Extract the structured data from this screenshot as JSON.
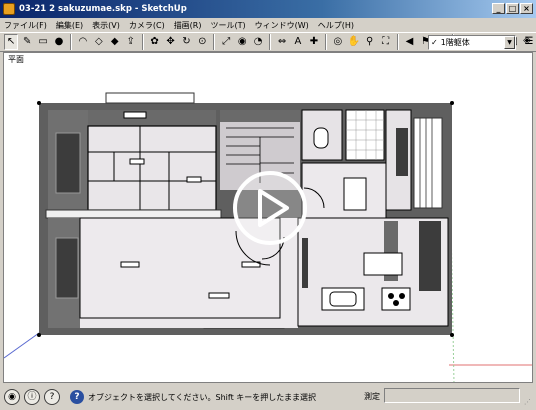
{
  "window": {
    "title": "03-21 2 sakuzumae.skp - SketchUp",
    "min": "_",
    "max": "□",
    "close": "×"
  },
  "menu": [
    "ファイル(F)",
    "編集(E)",
    "表示(V)",
    "カメラ(C)",
    "描画(R)",
    "ツール(T)",
    "ウィンドウ(W)",
    "ヘルプ(H)"
  ],
  "toolbar": {
    "tools": [
      {
        "name": "select-icon",
        "glyph": "↖"
      },
      {
        "name": "pencil-icon",
        "glyph": "✎"
      },
      {
        "name": "rectangle-icon",
        "glyph": "▭"
      },
      {
        "name": "circle-icon",
        "glyph": "●"
      },
      {
        "name": "arc-icon",
        "glyph": "◠"
      },
      {
        "name": "eraser-icon",
        "glyph": "◇"
      },
      {
        "name": "paint-bucket-icon",
        "glyph": "◆"
      },
      {
        "name": "push-pull-icon",
        "glyph": "⇪"
      },
      {
        "name": "follow-me-icon",
        "glyph": "✿"
      },
      {
        "name": "move-icon",
        "glyph": "✥"
      },
      {
        "name": "rotate-icon",
        "glyph": "↻"
      },
      {
        "name": "offset-icon",
        "glyph": "⊙"
      },
      {
        "name": "scale-icon",
        "glyph": "⤢"
      },
      {
        "name": "tape-measure-icon",
        "glyph": "◉"
      },
      {
        "name": "protractor-icon",
        "glyph": "◔"
      },
      {
        "name": "dimension-icon",
        "glyph": "⇔"
      },
      {
        "name": "text-icon",
        "glyph": "A"
      },
      {
        "name": "axes-icon",
        "glyph": "✚"
      },
      {
        "name": "orbit-icon",
        "glyph": "◎"
      },
      {
        "name": "pan-icon",
        "glyph": "✋"
      },
      {
        "name": "zoom-icon",
        "glyph": "⚲"
      },
      {
        "name": "zoom-extents-icon",
        "glyph": "⛶"
      },
      {
        "name": "previous-view-icon",
        "glyph": "◀"
      },
      {
        "name": "walk-icon",
        "glyph": "⚑"
      },
      {
        "name": "look-around-icon",
        "glyph": "◐"
      },
      {
        "name": "position-camera-icon",
        "glyph": "⚐"
      },
      {
        "name": "section-plane-icon",
        "glyph": "▤"
      },
      {
        "name": "component-icon",
        "glyph": "❖"
      },
      {
        "name": "materials-icon",
        "glyph": "▣"
      },
      {
        "name": "layers-icon",
        "glyph": "☰"
      }
    ],
    "layer_checked": "✓",
    "layer_value": "1階躯体",
    "layer_arrow": "▼",
    "layer_manager": "◈"
  },
  "viewport": {
    "scene": "平面"
  },
  "status": {
    "nav": [
      "◉",
      "ⓘ",
      "?"
    ],
    "help": "?",
    "message": "オブジェクトを選択してください。Shift キーを押したまま選択",
    "measure_label": "測定",
    "grip": "⋰"
  }
}
